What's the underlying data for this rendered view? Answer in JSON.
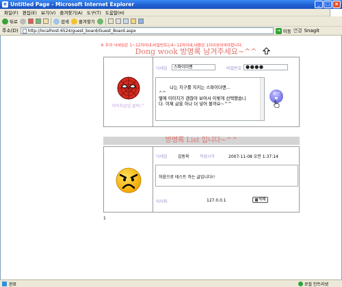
{
  "window": {
    "title": "Untitled Page - Microsoft Internet Explorer",
    "minimize": "_",
    "maximize": "□",
    "close": "×"
  },
  "menu": [
    "파일(F)",
    "편집(E)",
    "보기(V)",
    "즐겨찾기(A)",
    "도구(T)",
    "도움말(H)"
  ],
  "toolbar": {
    "back": "뒤로",
    "search": "검색",
    "favorites": "즐겨찾기"
  },
  "address": {
    "label": "주소(D)",
    "url": "http://localhost:6524/guest_board/Guest_Board.aspx",
    "go": "이동",
    "links": "연결",
    "snagit": "Snagit"
  },
  "page": {
    "notice": "※ 주의 닉네임은 1~12자이내,비밀번호는4~12자이내,내용은 1자이상이여야합니다.",
    "sign_title": "Dong wook 방명록 남겨주세요~^^",
    "form": {
      "nickname_label": "닉네임",
      "nickname_value": "스파이더맨",
      "password_label": "비밀번호",
      "password_value": "●●●●",
      "image_upload": "이미지삽입 클릭!^",
      "content": "나는 지구를 지키는 스파이더맨...\n^^\n옆에 이미지가 괜찮아 보여서 이렇게 선택했습니\n다. 이제 글을 하나 더 넣어 볼까요~^^",
      "confirm_line1": "확인",
      "confirm_line2": "♥"
    },
    "list_title": "방명록 List 입니다~^^",
    "entry": {
      "nickname_label": "닉네임",
      "nickname_value": "김동욱",
      "date_label": "작성시각",
      "date_value": "2007-11-08 오전 1:37:14",
      "content": "처음으로 테스트 하는 글입니다!!",
      "ip_label": "아이피",
      "ip_value": "127.0.0.1",
      "delete": "삭제"
    },
    "page_number": "1"
  },
  "status": {
    "left": "완료",
    "zone": "로컬 인트라넷"
  }
}
